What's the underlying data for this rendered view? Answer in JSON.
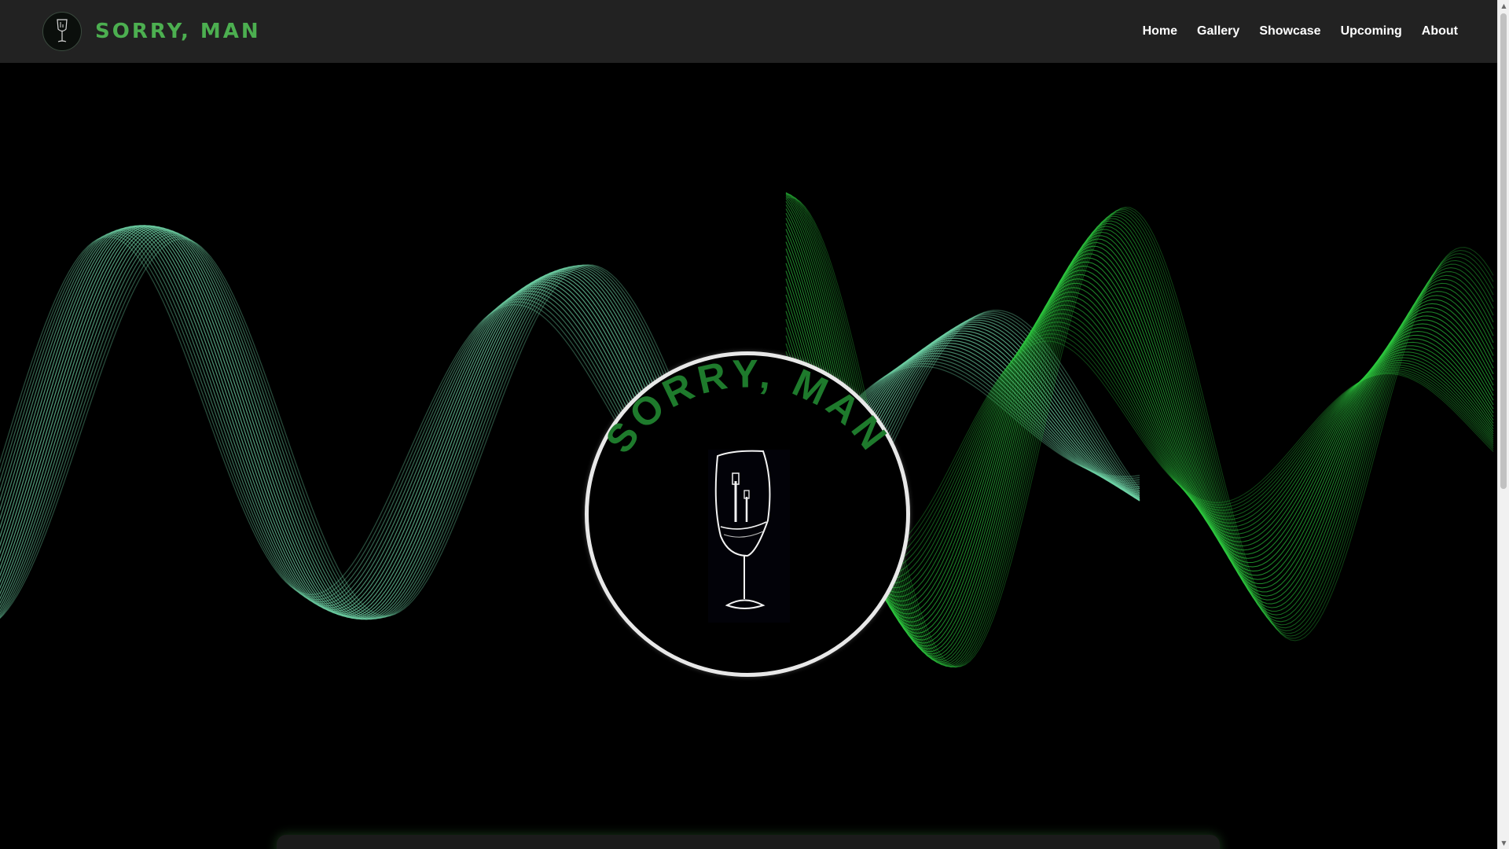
{
  "brand": {
    "title": "SORRY, MAN",
    "logo_icon": "wine-glass-guitar-icon"
  },
  "nav": {
    "items": [
      {
        "label": "Home"
      },
      {
        "label": "Gallery"
      },
      {
        "label": "Showcase"
      },
      {
        "label": "Upcoming"
      },
      {
        "label": "About"
      }
    ]
  },
  "hero": {
    "logo_text": "SORRY, MAN",
    "logo_icon": "wine-glass-guitar-icon",
    "background": "green-sound-waves"
  },
  "colors": {
    "accent": "#4caf50",
    "logo_text": "#1e7a2c",
    "navbar": "#222222",
    "background": "#000000",
    "wave_left": "#6fd3a6",
    "wave_right": "#2ecc40"
  },
  "scrollbar": {
    "up_icon": "scroll-up-arrow-icon",
    "down_icon": "scroll-down-arrow-icon"
  }
}
